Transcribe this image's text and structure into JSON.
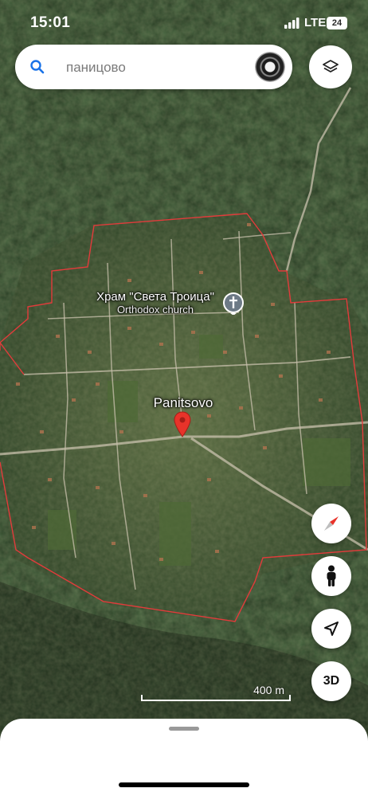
{
  "status_bar": {
    "time": "15:01",
    "network": "LTE",
    "battery": "24"
  },
  "search": {
    "placeholder": "паницово"
  },
  "map": {
    "church": {
      "name": "Храм \"Света Троица\"",
      "type": "Orthodox church"
    },
    "village": {
      "name": "Panitsovo"
    },
    "scale": {
      "label": "400 m"
    }
  },
  "controls": {
    "layers": "layers-icon",
    "compass": "compass-icon",
    "street_view": "pegman-icon",
    "my_location": "navigation-arrow-icon",
    "view_3d": "3D"
  },
  "colors": {
    "boundary": "#e23b3b",
    "pin": "#e8332a",
    "search_accent": "#1a73e8"
  }
}
